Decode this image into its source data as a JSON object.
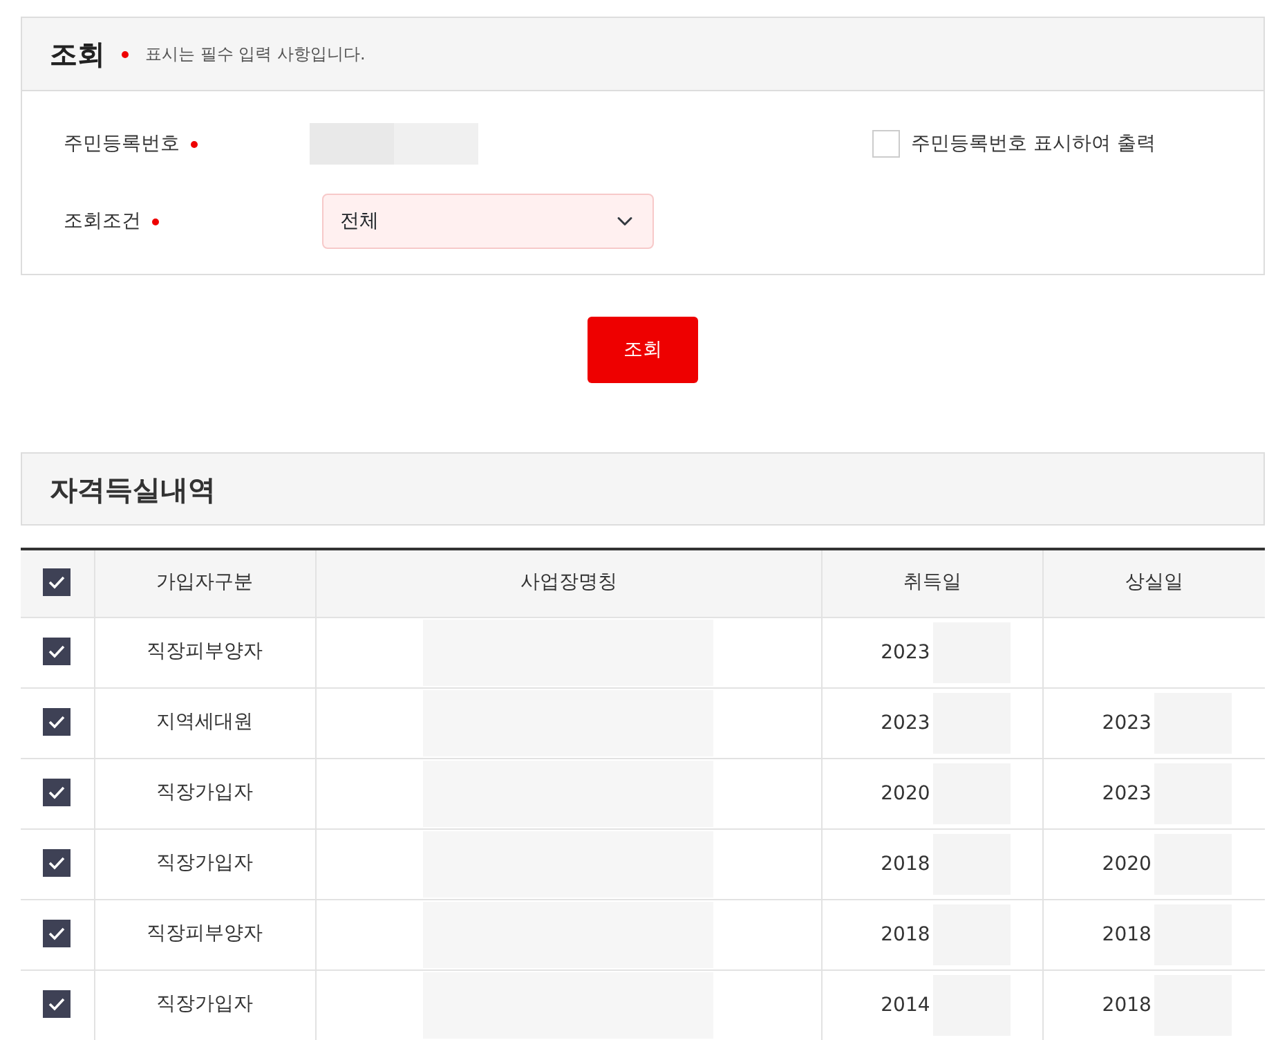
{
  "search_panel": {
    "title": "조회",
    "required_note": "표시는 필수 입력 사항입니다.",
    "fields": [
      {
        "kind": "masked",
        "label": "주민등록번호",
        "required": true
      },
      {
        "kind": "select",
        "label": "조회조건",
        "required": true,
        "value": "전체"
      }
    ],
    "print_option": {
      "label": "주민등록번호 표시하여 출력",
      "checked": false
    }
  },
  "search_button": "조회",
  "results": {
    "title": "자격득실내역",
    "header_checked": true,
    "columns": [
      "가입자구분",
      "사업장명칭",
      "취득일",
      "상실일"
    ],
    "rows": [
      {
        "checked": true,
        "type": "직장피부양자",
        "acquired": "2023",
        "lost": ""
      },
      {
        "checked": true,
        "type": "지역세대원",
        "acquired": "2023",
        "lost": "2023"
      },
      {
        "checked": true,
        "type": "직장가입자",
        "acquired": "2020",
        "lost": "2023"
      },
      {
        "checked": true,
        "type": "직장가입자",
        "acquired": "2018",
        "lost": "2020"
      },
      {
        "checked": true,
        "type": "직장피부양자",
        "acquired": "2018",
        "lost": "2018"
      },
      {
        "checked": true,
        "type": "직장가입자",
        "acquired": "2014",
        "lost": "2018"
      }
    ]
  }
}
